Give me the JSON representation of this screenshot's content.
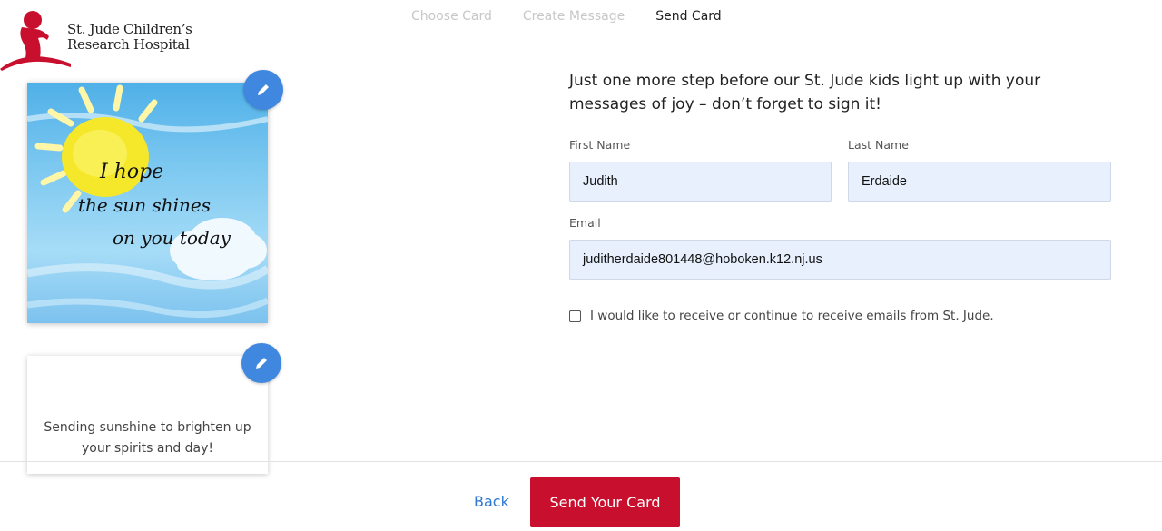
{
  "brand": {
    "name_line1": "St. Jude Children’s",
    "name_line2": "Research Hospital",
    "logo_color": "#c8102e"
  },
  "steps": [
    {
      "label": "Choose Card",
      "active": false
    },
    {
      "label": "Create Message",
      "active": false
    },
    {
      "label": "Send Card",
      "active": true
    }
  ],
  "card": {
    "front_art_text": "I hope the sun shines on you today",
    "back_message": "Sending sunshine to brighten up your spirits and day!",
    "edit_icon": "pencil-icon"
  },
  "form": {
    "heading": "Just one more step before our St. Jude kids light up with your messages of joy – don’t forget to sign it!",
    "first_name": {
      "label": "First Name",
      "value": "Judith"
    },
    "last_name": {
      "label": "Last Name",
      "value": "Erdaide"
    },
    "email": {
      "label": "Email",
      "value": "juditherdaide801448@hoboken.k12.nj.us"
    },
    "optin_label": "I would like to receive or continue to receive emails from St. Jude.",
    "optin_checked": false
  },
  "footer": {
    "back_label": "Back",
    "send_label": "Send Your Card"
  },
  "colors": {
    "accent_red": "#c8102e",
    "link_blue": "#2e78d2",
    "edit_blue": "#3f87df",
    "field_bg": "#e8f0fe"
  }
}
